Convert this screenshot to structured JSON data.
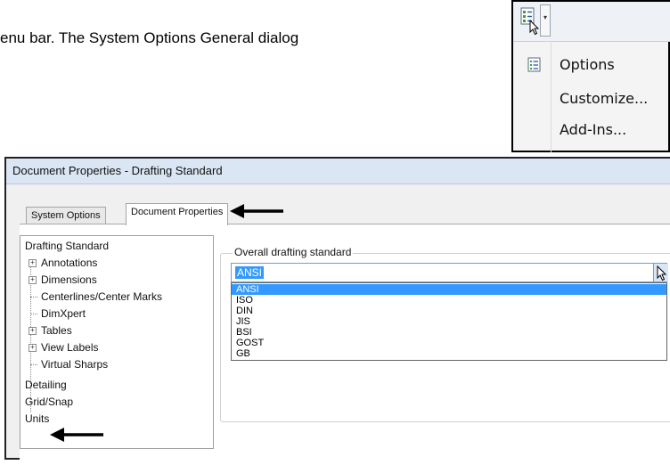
{
  "caption": "enu bar. The System Options General dialog",
  "flyout": {
    "toolbar_icon": "options-checklist-icon",
    "dropdown_glyph": "▾",
    "items": [
      {
        "label": "Options",
        "icon": "options-checklist-icon"
      },
      {
        "label": "Customize..."
      },
      {
        "label": "Add-Ins..."
      }
    ]
  },
  "dialog": {
    "title": "Document Properties - Drafting Standard",
    "tabs": [
      {
        "label": "System Options",
        "active": false
      },
      {
        "label": "Document Properties",
        "active": true
      }
    ],
    "tree": [
      {
        "label": "Drafting Standard",
        "level": 0,
        "expandable": false,
        "selected": true
      },
      {
        "label": "Annotations",
        "level": 1,
        "expandable": true
      },
      {
        "label": "Dimensions",
        "level": 1,
        "expandable": true
      },
      {
        "label": "Centerlines/Center Marks",
        "level": 1,
        "expandable": false
      },
      {
        "label": "DimXpert",
        "level": 1,
        "expandable": false
      },
      {
        "label": "Tables",
        "level": 1,
        "expandable": true
      },
      {
        "label": "View Labels",
        "level": 1,
        "expandable": true
      },
      {
        "label": "Virtual Sharps",
        "level": 1,
        "expandable": false
      },
      {
        "label": "Detailing",
        "level": 0,
        "expandable": false
      },
      {
        "label": "Grid/Snap",
        "level": 0,
        "expandable": false
      },
      {
        "label": "Units",
        "level": 0,
        "expandable": false
      }
    ],
    "group_label": "Overall drafting standard",
    "combo_value": "ANSI",
    "options": [
      "ANSI",
      "ISO",
      "DIN",
      "JIS",
      "BSI",
      "GOST",
      "GB"
    ],
    "highlighted_option": "ANSI"
  },
  "colors": {
    "selection": "#3399ff",
    "titlebar": "#dbe6f4",
    "annotation_arrow": "#000000"
  }
}
